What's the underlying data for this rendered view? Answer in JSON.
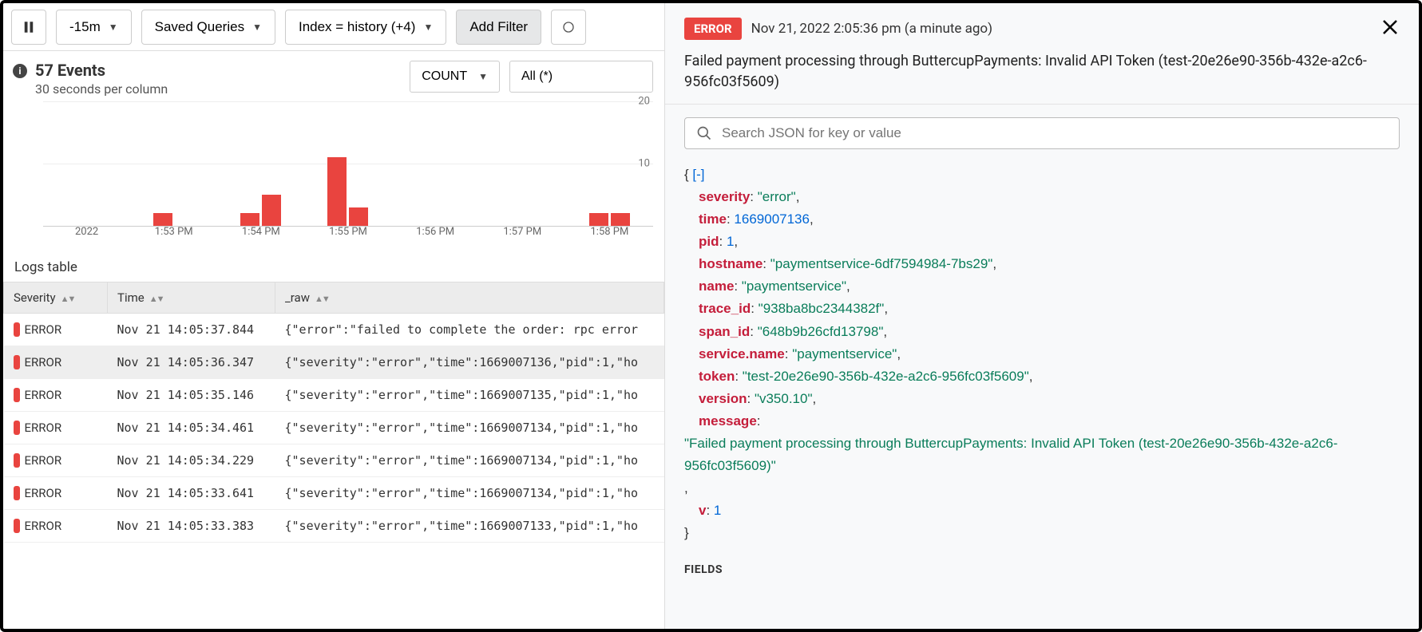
{
  "toolbar": {
    "timerange": "-15m",
    "saved_queries": "Saved Queries",
    "index": "Index = history (+4)",
    "add_filter": "Add Filter"
  },
  "summary": {
    "events_count": "57 Events",
    "per_column": "30 seconds per column",
    "agg": "COUNT",
    "scope": "All (*)"
  },
  "chart_data": {
    "type": "bar",
    "ylabel": "",
    "ylim": [
      0,
      20
    ],
    "yticks": [
      10,
      20
    ],
    "categories": [
      "2022",
      "1:53 PM",
      "1:54 PM",
      "1:55 PM",
      "1:56 PM",
      "1:57 PM",
      "1:58 PM"
    ],
    "bars": [
      {
        "label": "2022",
        "sub": [
          0,
          0
        ]
      },
      {
        "label": "1:53 PM",
        "sub": [
          2,
          0
        ]
      },
      {
        "label": "1:54 PM",
        "sub": [
          2,
          5
        ]
      },
      {
        "label": "1:55 PM",
        "sub": [
          11,
          3
        ]
      },
      {
        "label": "1:56 PM",
        "sub": [
          0,
          0
        ]
      },
      {
        "label": "1:57 PM",
        "sub": [
          0,
          0
        ]
      },
      {
        "label": "1:58 PM",
        "sub": [
          2,
          2
        ]
      }
    ]
  },
  "logs": {
    "title": "Logs table",
    "columns": {
      "severity": "Severity",
      "time": "Time",
      "raw": "_raw"
    },
    "rows": [
      {
        "severity": "ERROR",
        "time": "Nov 21 14:05:37.844",
        "raw": "{\"error\":\"failed to complete the order: rpc error",
        "selected": false
      },
      {
        "severity": "ERROR",
        "time": "Nov 21 14:05:36.347",
        "raw": "{\"severity\":\"error\",\"time\":1669007136,\"pid\":1,\"ho",
        "selected": true
      },
      {
        "severity": "ERROR",
        "time": "Nov 21 14:05:35.146",
        "raw": "{\"severity\":\"error\",\"time\":1669007135,\"pid\":1,\"ho",
        "selected": false
      },
      {
        "severity": "ERROR",
        "time": "Nov 21 14:05:34.461",
        "raw": "{\"severity\":\"error\",\"time\":1669007134,\"pid\":1,\"ho",
        "selected": false
      },
      {
        "severity": "ERROR",
        "time": "Nov 21 14:05:34.229",
        "raw": "{\"severity\":\"error\",\"time\":1669007134,\"pid\":1,\"ho",
        "selected": false
      },
      {
        "severity": "ERROR",
        "time": "Nov 21 14:05:33.641",
        "raw": "{\"severity\":\"error\",\"time\":1669007134,\"pid\":1,\"ho",
        "selected": false
      },
      {
        "severity": "ERROR",
        "time": "Nov 21 14:05:33.383",
        "raw": "{\"severity\":\"error\",\"time\":1669007133,\"pid\":1,\"ho",
        "selected": false
      }
    ]
  },
  "detail": {
    "badge": "ERROR",
    "timestamp": "Nov 21, 2022 2:05:36 pm (a minute ago)",
    "message": "Failed payment processing through ButtercupPayments: Invalid API Token (test-20e26e90-356b-432e-a2c6-956fc03f5609)",
    "search_placeholder": "Search JSON for key or value",
    "toggle": "[-]",
    "json": {
      "severity": "\"error\"",
      "time": "1669007136",
      "pid": "1",
      "hostname": "\"paymentservice-6df7594984-7bs29\"",
      "name": "\"paymentservice\"",
      "trace_id": "\"938ba8bc2344382f\"",
      "span_id": "\"648b9b26cfd13798\"",
      "service_name_key": "service.name",
      "service_name": "\"paymentservice\"",
      "token": "\"test-20e26e90-356b-432e-a2c6-956fc03f5609\"",
      "version": "\"v350.10\"",
      "message_key": "message",
      "message_val": "\"Failed payment processing through ButtercupPayments: Invalid API Token (test-20e26e90-356b-432e-a2c6-956fc03f5609)\"",
      "v": "1"
    },
    "fields_header": "FIELDS"
  }
}
